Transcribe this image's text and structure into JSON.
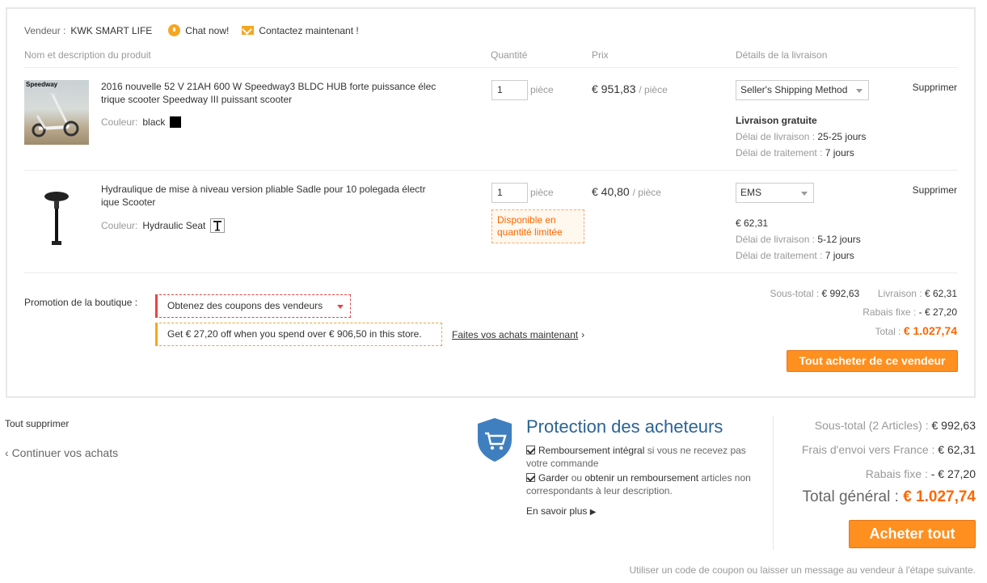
{
  "seller": {
    "label": "Vendeur :",
    "name": "KWK SMART LIFE",
    "chat": "Chat now!",
    "contact": "Contactez maintenant !"
  },
  "columns": {
    "product": "Nom et description du produit",
    "quantity": "Quantité",
    "price": "Prix",
    "delivery": "Détails de la livraison"
  },
  "items": [
    {
      "title": "2016 nouvelle 52 V 21AH 600 W Speedway3 BLDC HUB forte puissance élec trique scooter Speedway III puissant scooter",
      "thumb_brand": "Speedway",
      "color_label": "Couleur:",
      "color_value": "black",
      "quantity": "1",
      "unit": "pièce",
      "price": "€ 951,83",
      "per": "/ pièce",
      "shipping_method": "Seller's Shipping Method",
      "shipping_cost": "Livraison gratuite",
      "delivery_label": "Délai de livraison :",
      "delivery_value": "25-25 jours",
      "processing_label": "Délai de traitement :",
      "processing_value": "7 jours",
      "delete": "Supprimer"
    },
    {
      "title": "Hydraulique de mise à niveau version pliable Sadle pour 10 polegada électr ique Scooter",
      "color_label": "Couleur:",
      "color_value": "Hydraulic Seat",
      "quantity": "1",
      "unit": "pièce",
      "stock_note": "Disponible en quantité limitée",
      "price": "€ 40,80",
      "per": "/ pièce",
      "shipping_method": "EMS",
      "shipping_cost": "€ 62,31",
      "delivery_label": "Délai de livraison :",
      "delivery_value": "5-12 jours",
      "processing_label": "Délai de traitement :",
      "processing_value": "7 jours",
      "delete": "Supprimer"
    }
  ],
  "promo": {
    "label": "Promotion de la boutique :",
    "coupons": "Obtenez des coupons des vendeurs",
    "offer": "Get € 27,20 off when you spend over € 906,50 in this store.",
    "shop_now": "Faites vos achats maintenant"
  },
  "store_summary": {
    "subtotal_label": "Sous-total :",
    "subtotal": "€ 992,63",
    "shipping_label": "Livraison :",
    "shipping": "€ 62,31",
    "discount_label": "Rabais fixe :",
    "discount": "- € 27,20",
    "total_label": "Total :",
    "total": "€ 1.027,74",
    "buy_vendor": "Tout acheter de ce vendeur"
  },
  "actions": {
    "delete_all": "Tout supprimer",
    "continue": "Continuer vos achats"
  },
  "protection": {
    "title": "Protection des acheteurs",
    "item1_strong": "Remboursement intégral",
    "item1_rest": " si vous ne recevez pas votre commande",
    "item2_strong": "Garder",
    "item2_mid": " ou ",
    "item2_strong2": "obtenir un remboursement",
    "item2_rest": " articles non correspondants à leur description.",
    "learn_more": "En savoir plus"
  },
  "order_summary": {
    "subtotal_label": "Sous-total (2 Articles) :",
    "subtotal": "€ 992,63",
    "shipping_label": "Frais d'envoi vers France :",
    "shipping": "€ 62,31",
    "discount_label": "Rabais fixe :",
    "discount": "- € 27,20",
    "total_label": "Total général :",
    "total": "€ 1.027,74",
    "buy_all": "Acheter tout",
    "footnote": "Utiliser un code de coupon ou laisser un message au vendeur à l'étape suivante."
  },
  "colors": {
    "accent_orange": "#ff8f1f",
    "total_orange": "#ff6600",
    "protection_blue": "#2a6496",
    "coupon_red": "#e64545"
  }
}
